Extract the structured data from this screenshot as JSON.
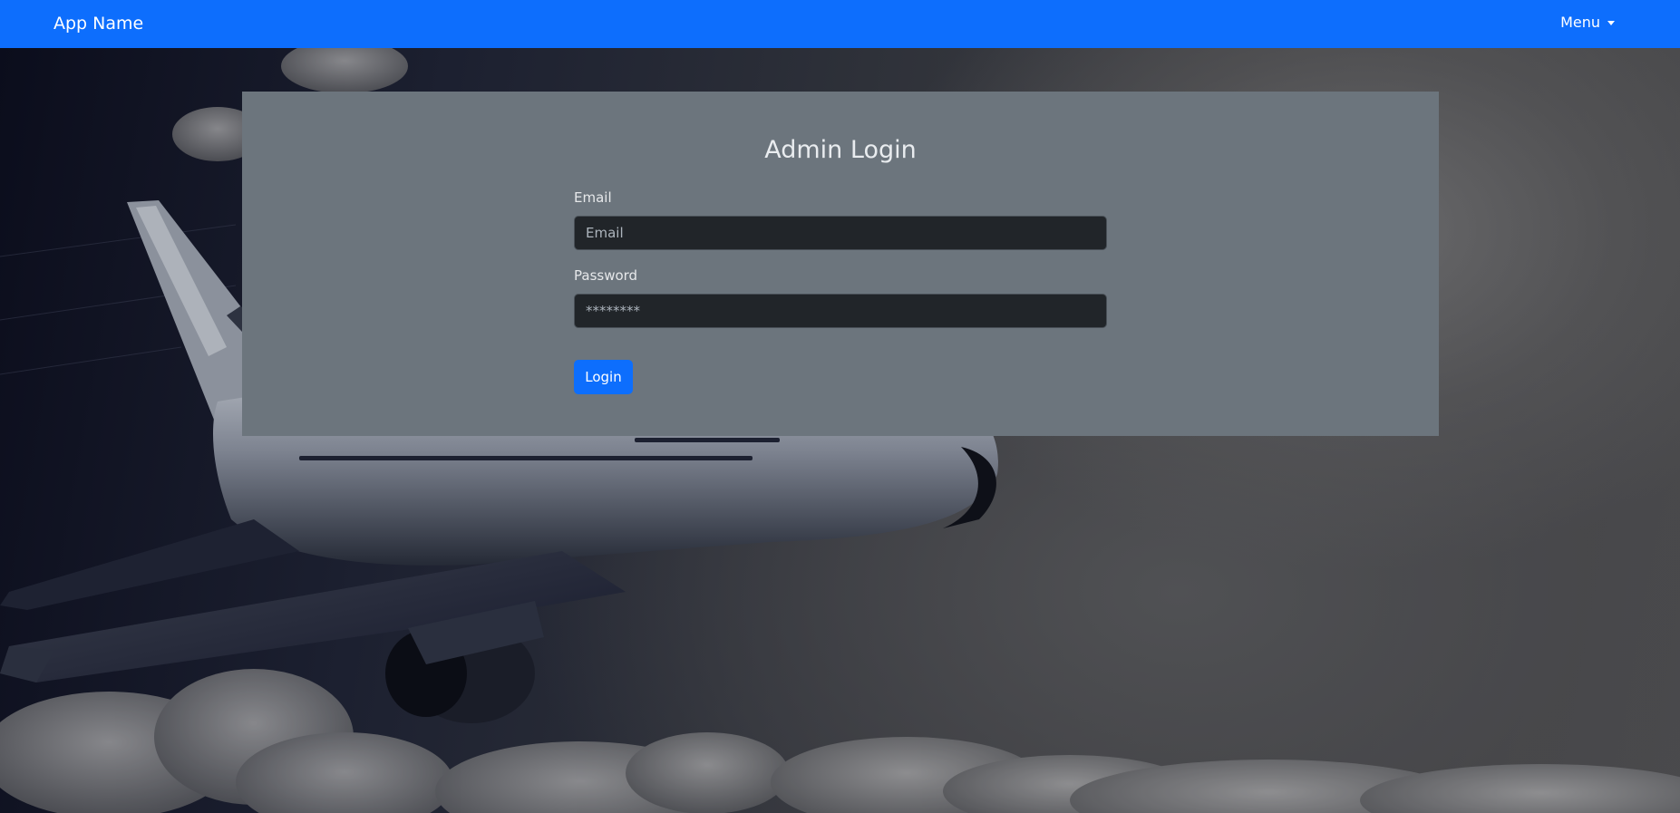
{
  "navbar": {
    "brand": "App Name",
    "menu_label": "Menu",
    "color": "#0d6efd"
  },
  "login": {
    "title": "Admin Login",
    "email_label": "Email",
    "email_placeholder": "Email",
    "email_value": "",
    "password_label": "Password",
    "password_placeholder": "********",
    "password_value": "",
    "submit_label": "Login",
    "card_color": "#6c757d",
    "button_color": "#0d6efd"
  },
  "background": {
    "icons": [
      "airplane-image",
      "clouds-image"
    ]
  }
}
